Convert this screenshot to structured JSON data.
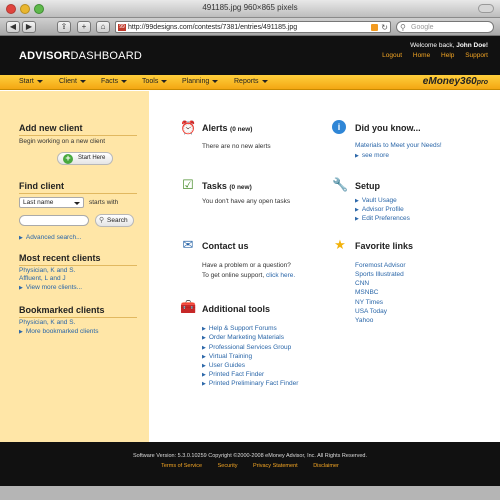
{
  "window": {
    "title": "491185.jpg 960×865 pixels"
  },
  "browser": {
    "url": "http://99designs.com/contests/7381/entries/491185.jpg",
    "search_placeholder": "Google",
    "back": "◀",
    "forward": "▶",
    "share": "⇪",
    "add": "+",
    "home_label": "⌂"
  },
  "header": {
    "logo_bold": "ADVISOR",
    "logo_rest": "DASHBOARD",
    "welcome_prefix": "Welcome back,",
    "user": "John Doe!",
    "links": [
      "Logout",
      "Home",
      "Help",
      "Support"
    ]
  },
  "menu": {
    "items": [
      "Start",
      "Client",
      "Facts",
      "Tools",
      "Planning",
      "Reports"
    ],
    "brand": "eMoney",
    "brand_suffix": "360",
    "brand_pro": "pro"
  },
  "sidebar": {
    "add_client": {
      "title": "Add new client",
      "text": "Begin working on a new client",
      "button": "Start Here"
    },
    "find_client": {
      "title": "Find client",
      "select_value": "Last name",
      "starts_with": "starts with",
      "search_button": "Search",
      "advanced": "Advanced search..."
    },
    "recent": {
      "title": "Most recent clients",
      "items": [
        "Physician, K and S.",
        "Affluent, L and J"
      ],
      "more": "View more clients..."
    },
    "bookmarked": {
      "title": "Bookmarked clients",
      "items": [
        "Physician, K and S."
      ],
      "more": "More bookmarked clients"
    }
  },
  "main": {
    "alerts": {
      "title": "Alerts",
      "count": "(0 new)",
      "text": "There are no new alerts"
    },
    "tasks": {
      "title": "Tasks",
      "count": "(0 new)",
      "text": "You don't have any open tasks"
    },
    "contact": {
      "title": "Contact us",
      "line1": "Have a problem or a question?",
      "line2": "To get online support,",
      "link": "click here."
    },
    "tools": {
      "title": "Additional tools",
      "items": [
        "Help & Support Forums",
        "Order Marketing Materials",
        "Professional Services Group",
        "Virtual Training",
        "User Guides",
        "Printed Fact Finder",
        "Printed Preliminary Fact Finder"
      ]
    },
    "didyouknow": {
      "title": "Did you know...",
      "link": "Materials to Meet your Needs!",
      "more": "see more"
    },
    "setup": {
      "title": "Setup",
      "items": [
        "Vault Usage",
        "Advisor Profile",
        "Edit Preferences"
      ]
    },
    "favorites": {
      "title": "Favorite links",
      "items": [
        "Foremost Advisor",
        "Sports Illustrated",
        "CNN",
        "MSNBC",
        "NY Times",
        "USA Today",
        "Yahoo"
      ]
    }
  },
  "footer": {
    "version": "Software Version: 5.3.0.10259 Copyright ©2000-2008 eMoney Advisor, Inc. All Rights Reserved.",
    "links": [
      "Terms of Service",
      "Security",
      "Privacy Statement",
      "Disclaimer"
    ]
  },
  "colors": {
    "accent": "#f5a623",
    "menu": "#ffc02a",
    "sidebar": "#ffe6a7",
    "link": "#2a66a8",
    "dark": "#111111"
  },
  "icons": {
    "alerts": "alarm-clock-icon",
    "tasks": "checklist-icon",
    "contact": "envelope-icon",
    "tools": "toolbox-icon",
    "didyouknow": "info-icon",
    "setup": "wrench-icon",
    "favorites": "star-icon"
  }
}
